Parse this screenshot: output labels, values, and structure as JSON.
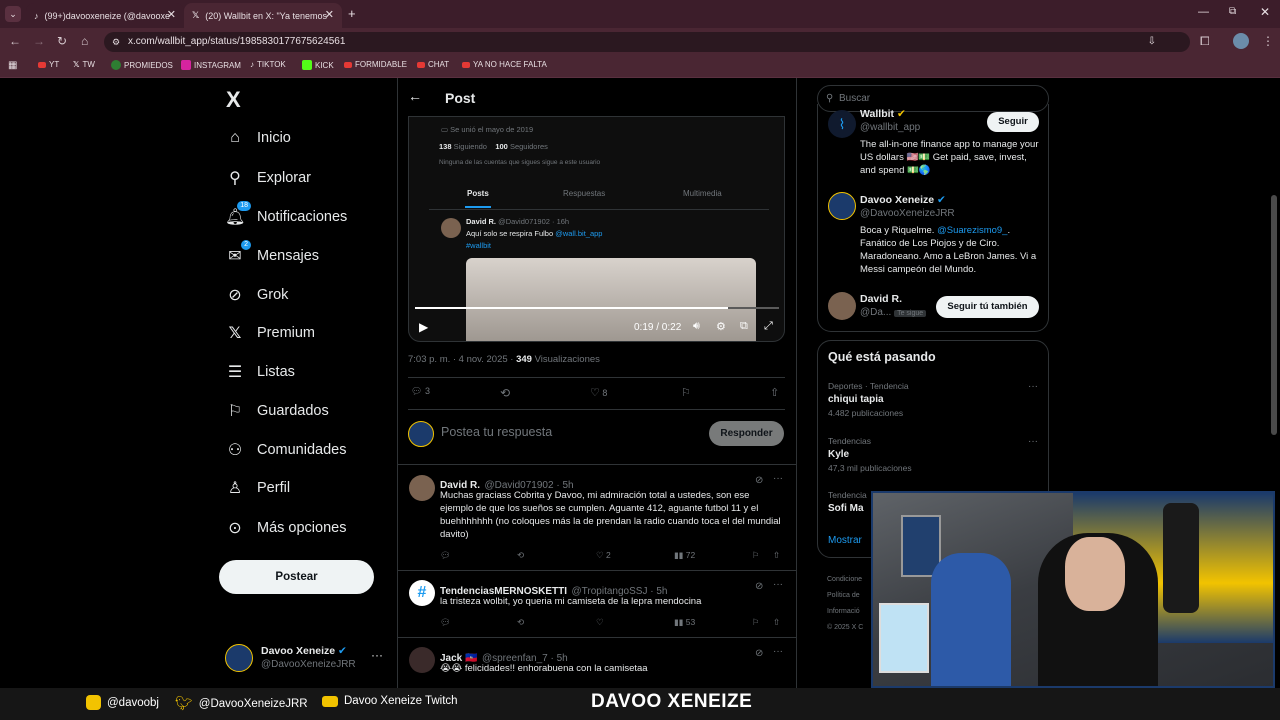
{
  "browser": {
    "tabs": [
      {
        "label": "(99+)davooxeneize (@davooxe"
      },
      {
        "label": "(20) Wallbit en X: \"Ya tenemos"
      }
    ],
    "url": "x.com/wallbit_app/status/1985830177675624561",
    "bookmarks": [
      "YT",
      "TW",
      "PROMIEDOS",
      "INSTAGRAM",
      "TIKTOK",
      "KICK",
      "FORMIDABLE",
      "CHAT",
      "YA NO HACE FALTA"
    ]
  },
  "sidebar": {
    "logo": "X",
    "items": [
      {
        "label": "Inicio",
        "icon": "home-icon"
      },
      {
        "label": "Explorar",
        "icon": "search-icon"
      },
      {
        "label": "Notificaciones",
        "icon": "bell-icon",
        "badge": "18"
      },
      {
        "label": "Mensajes",
        "icon": "mail-icon",
        "badge": "2"
      },
      {
        "label": "Grok",
        "icon": "grok-icon"
      },
      {
        "label": "Premium",
        "icon": "x-icon"
      },
      {
        "label": "Listas",
        "icon": "list-icon"
      },
      {
        "label": "Guardados",
        "icon": "bookmark-icon"
      },
      {
        "label": "Comunidades",
        "icon": "people-icon"
      },
      {
        "label": "Perfil",
        "icon": "person-icon"
      },
      {
        "label": "Más opciones",
        "icon": "more-icon"
      }
    ],
    "post_button": "Postear",
    "account": {
      "name": "Davoo Xeneize",
      "handle": "@DavooXeneizeJRR"
    }
  },
  "header": {
    "title": "Post"
  },
  "video": {
    "joined": "Se unió el mayo de 2019",
    "following_count": "138",
    "following_label": "Siguiendo",
    "followers_count": "100",
    "followers_label": "Seguidores",
    "mutuals": "Ninguna de las cuentas que sigues sigue a este usuario",
    "tabs": [
      "Posts",
      "Respuestas",
      "Multimedia"
    ],
    "inner_name": "David R.",
    "inner_handle": "@David071902 · 16h",
    "inner_text": "Aquí solo se respira Fulbo",
    "inner_mention": "@wall.bit_app",
    "inner_hashtag": "#wallbit",
    "time": "0:19 / 0:22",
    "progress": 0.86
  },
  "post": {
    "timestamp": "7:03 p. m. · 4 nov. 2025 · ",
    "views_count": "349",
    "views_label": " Visualizaciones",
    "replies": "3",
    "likes": "8"
  },
  "compose": {
    "placeholder": "Postea tu respuesta",
    "button": "Responder"
  },
  "replies": [
    {
      "name": "David R.",
      "handle": "@David071902 · 5h",
      "text": "Muchas graciass Cobrita y Davoo, mi admiración total a ustedes, son ese ejemplo de que los sueños se cumplen. Aguante 412, aguante futbol 11 y el buehhhhhhh (no coloques más la de prendan la radio cuando toca el del mundial davito)",
      "likes": "2",
      "views": "72"
    },
    {
      "name": "TendenciasMERNOSKETTI",
      "handle": "@TropitangoSSJ · 5h",
      "text": "la tristeza wolbit, yo queria mi camiseta de la lepra mendocina",
      "likes": "",
      "views": "53"
    },
    {
      "name": "Jack 🇭🇹",
      "handle": "@spreenfan_7 · 5h",
      "text": "😭😭 felicidades!! enhorabuena con la camisetaa"
    }
  ],
  "right": {
    "search_placeholder": "Buscar",
    "who_to_follow": [
      {
        "name": "Wallbit",
        "handle": "@wallbit_app",
        "bio": "The all-in-one finance app to manage your US dollars 🇺🇸💵 Get paid, save, invest, and spend 💵🌎",
        "button": "Seguir"
      },
      {
        "name": "Davoo Xeneize",
        "handle": "@DavooXeneizeJRR",
        "bio_pre": "Boca y Riquelme. ",
        "bio_mention": "@Suarezismo9_",
        "bio_post": ". Fanático de Los Piojos y de Ciro. Maradoneano. Amo a LeBron James. Vi a Messi campeón del Mundo."
      },
      {
        "name": "David R.",
        "handle": "@Da...",
        "follows_you": "Te sigue",
        "button": "Seguir tú también"
      }
    ],
    "trends_title": "Qué está pasando",
    "trends": [
      {
        "meta": "Deportes · Tendencia",
        "name": "chiqui tapia",
        "count": "4.482 publicaciones"
      },
      {
        "meta": "Tendencias",
        "name": "Kyle",
        "count": "47,3 mil publicaciones"
      },
      {
        "meta": "Tendencia",
        "name": "Sofi Ma"
      }
    ],
    "show_more": "Mostrar",
    "footer": [
      "Condicione",
      "Política de",
      "Informació",
      "© 2025 X C"
    ]
  },
  "stream": {
    "instagram": "@davoobj",
    "twitter": "@DavooXeneizeJRR",
    "twitch": "Davoo Xeneize Twitch",
    "brand": "DAVOO XENEIZE"
  }
}
